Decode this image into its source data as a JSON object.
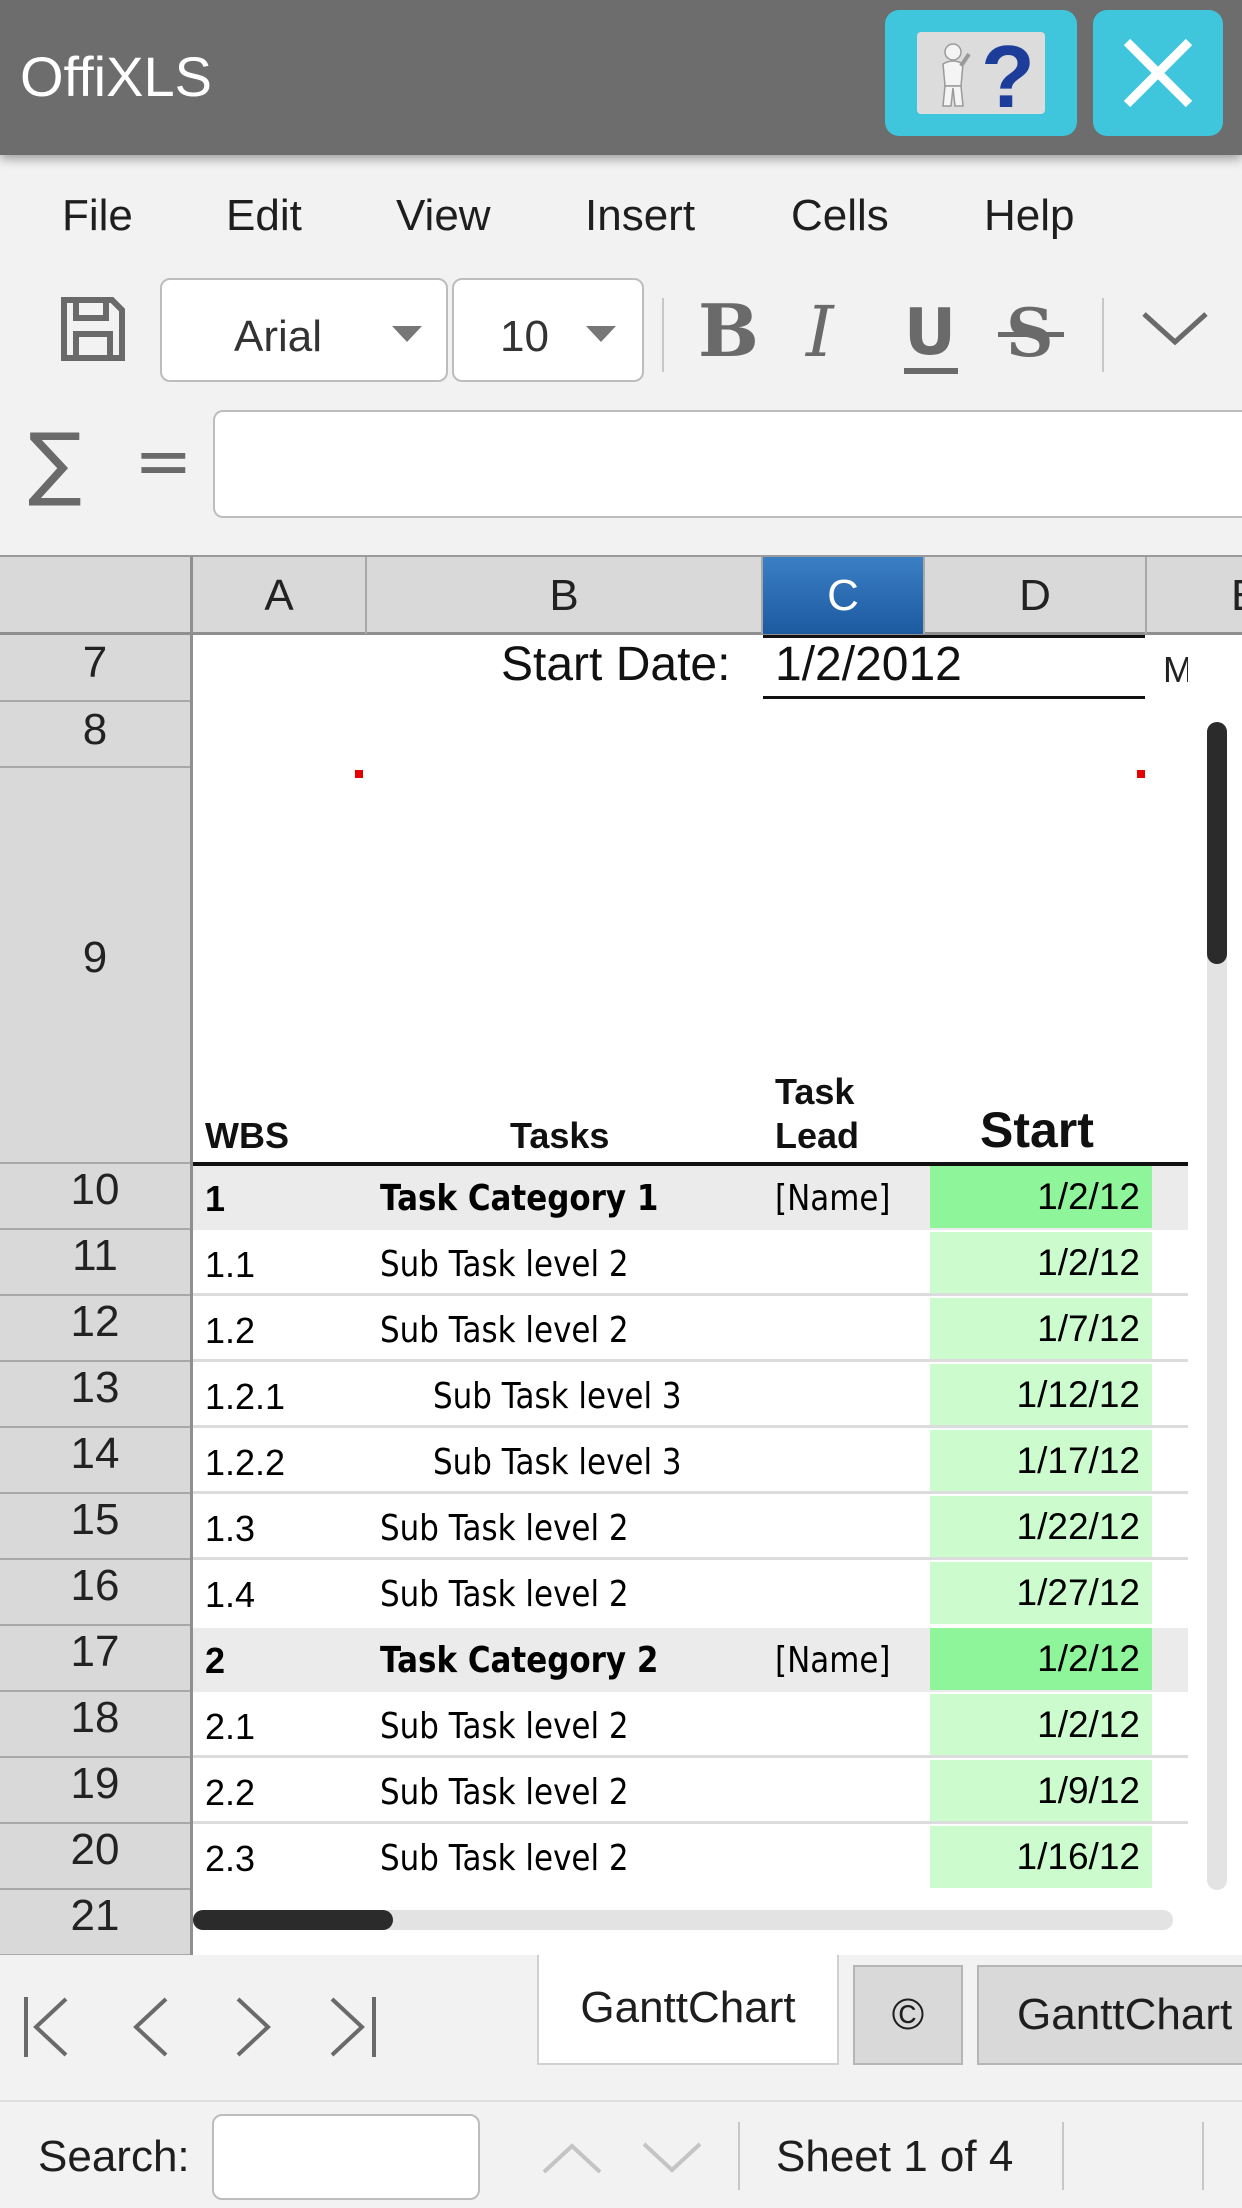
{
  "app": {
    "title": "OffiXLS"
  },
  "menu": [
    "File",
    "Edit",
    "View",
    "Insert",
    "Cells",
    "Help"
  ],
  "toolbar": {
    "font_name": "Arial",
    "font_size": "10"
  },
  "formula": {
    "sum_symbol": "∑",
    "equals_symbol": "=",
    "value": ""
  },
  "columns": [
    "A",
    "B",
    "C",
    "D",
    "E"
  ],
  "selected_column": "C",
  "rows": [
    "7",
    "8",
    "9",
    "10",
    "11",
    "12",
    "13",
    "14",
    "15",
    "16",
    "17",
    "18",
    "19",
    "20",
    "21"
  ],
  "sheet": {
    "start_date_label": "Start Date:",
    "start_date_value": "1/2/2012",
    "clipped_text": "M",
    "headers": {
      "wbs": "WBS",
      "tasks": "Tasks",
      "task_lead_1": "Task",
      "task_lead_2": "Lead",
      "start": "Start"
    },
    "data": [
      {
        "wbs": "1",
        "task": "Task Category 1",
        "lead": "[Name]",
        "start": "1/2/12",
        "level": 1
      },
      {
        "wbs": "1.1",
        "task": "Sub Task level 2",
        "lead": "",
        "start": "1/2/12",
        "level": 2
      },
      {
        "wbs": "1.2",
        "task": "Sub Task level 2",
        "lead": "",
        "start": "1/7/12",
        "level": 2
      },
      {
        "wbs": "1.2.1",
        "task": "Sub Task level 3",
        "lead": "",
        "start": "1/12/12",
        "level": 3
      },
      {
        "wbs": "1.2.2",
        "task": "Sub Task level 3",
        "lead": "",
        "start": "1/17/12",
        "level": 3
      },
      {
        "wbs": "1.3",
        "task": "Sub Task level 2",
        "lead": "",
        "start": "1/22/12",
        "level": 2
      },
      {
        "wbs": "1.4",
        "task": "Sub Task level 2",
        "lead": "",
        "start": "1/27/12",
        "level": 2
      },
      {
        "wbs": "2",
        "task": "Task Category 2",
        "lead": "[Name]",
        "start": "1/2/12",
        "level": 1
      },
      {
        "wbs": "2.1",
        "task": "Sub Task level 2",
        "lead": "",
        "start": "1/2/12",
        "level": 2
      },
      {
        "wbs": "2.2",
        "task": "Sub Task level 2",
        "lead": "",
        "start": "1/9/12",
        "level": 2
      },
      {
        "wbs": "2.3",
        "task": "Sub Task level 2",
        "lead": "",
        "start": "1/16/12",
        "level": 2
      }
    ]
  },
  "sheet_tabs": [
    "GanttChart",
    "©",
    "GanttChart"
  ],
  "status": {
    "search_label": "Search:",
    "search_value": "",
    "sheet_info": "Sheet 1 of 4"
  },
  "colors": {
    "titlebar": "#6d6d6d",
    "accent_button": "#3fc6dc",
    "selected_column": "#2a6cb3",
    "category_start_fill": "#8ff59a",
    "subtask_start_fill": "#ccfccd",
    "category_row_fill": "#ebebeb"
  },
  "icons": [
    "save-icon",
    "bold-icon",
    "italic-icon",
    "underline-icon",
    "strikethrough-icon",
    "chevron-down-icon",
    "help-icon",
    "close-icon",
    "first-sheet-icon",
    "prev-sheet-icon",
    "next-sheet-icon",
    "last-sheet-icon",
    "search-up-icon",
    "search-down-icon"
  ]
}
